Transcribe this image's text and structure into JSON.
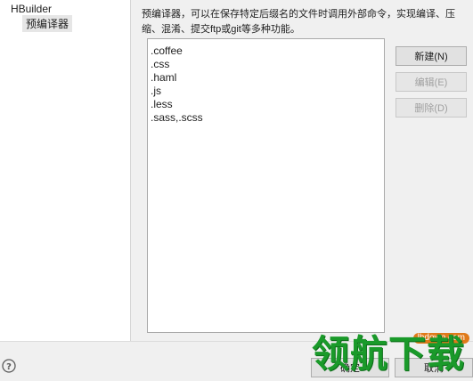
{
  "tree": {
    "cut_text": "",
    "root_label": "HBuilder",
    "child_label": "预编译器"
  },
  "description": "预编译器，可以在保存特定后缀名的文件时调用外部命令，实现编译、压缩、混淆、提交ftp或git等多种功能。",
  "extensions": [
    ".coffee",
    ".css",
    ".haml",
    ".js",
    ".less",
    ".sass,.scss"
  ],
  "buttons": {
    "new": "新建(N)",
    "edit": "编辑(E)",
    "delete": "删除(D)"
  },
  "bottom": {
    "help_icon": "question-circle-icon",
    "ok": "确定",
    "cancel": "取消"
  },
  "watermark": {
    "url": "lhdown.com",
    "text": "领航下载"
  },
  "colors": {
    "watermark_green": "#1a9a2a",
    "watermark_orange": "#e07a1a"
  }
}
